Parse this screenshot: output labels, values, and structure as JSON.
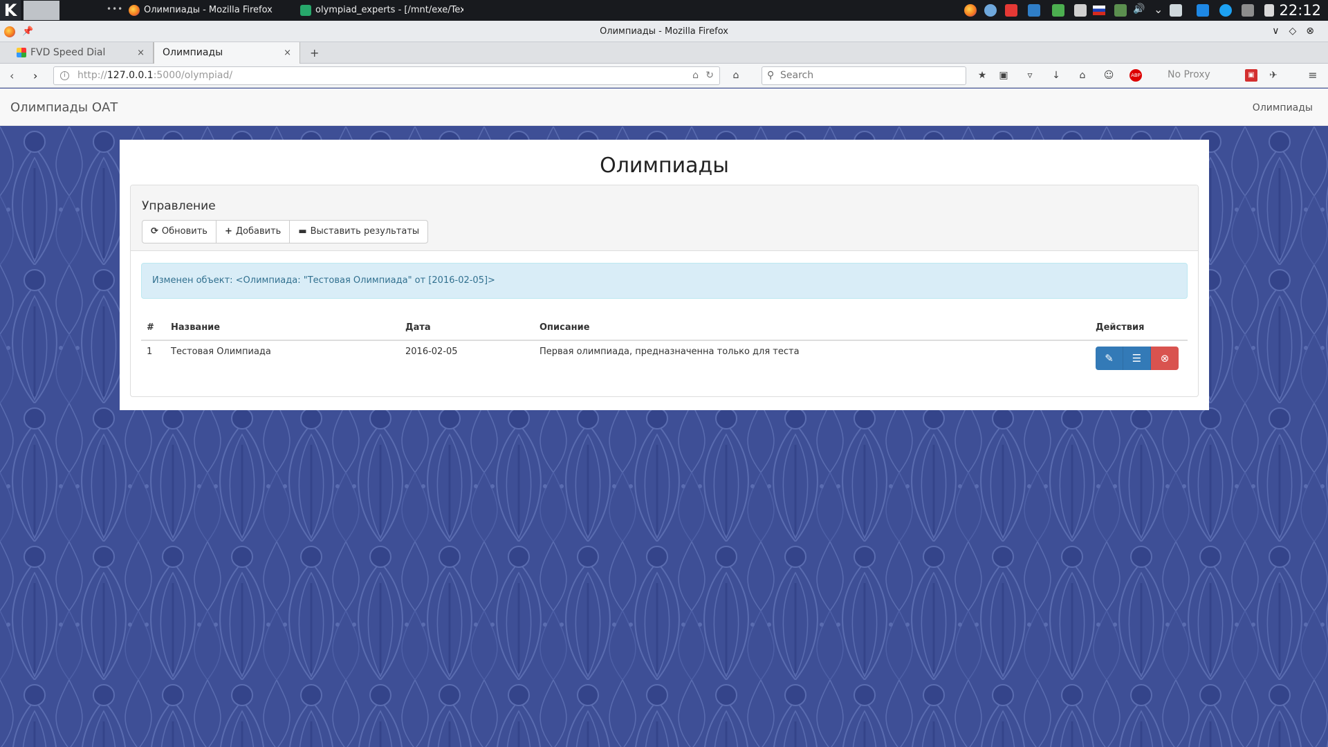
{
  "taskbar": {
    "k_label": "K",
    "dots": "•••",
    "task1": "Олимпиады - Mozilla Firefox",
    "task2": "olympiad_experts - [/mnt/exe/Text/",
    "clock": "22:12"
  },
  "window": {
    "title": "Олимпиады - Mozilla Firefox",
    "controls": "∨◇⊗"
  },
  "tabs": [
    {
      "label": "FVD Speed Dial",
      "close": "×"
    },
    {
      "label": "Олимпиады",
      "close": "×"
    }
  ],
  "newtab": "+",
  "nav": {
    "url_prefix": "http://",
    "url_host": "127.0.0.1",
    "url_rest": ":5000/olympiad/",
    "search_placeholder": "Search",
    "no_proxy": "No Proxy"
  },
  "site": {
    "brand": "Олимпиады ОАТ",
    "nav_link": "Олимпиады"
  },
  "page": {
    "title": "Олимпиады",
    "panel_title": "Управление",
    "buttons": {
      "refresh": "Обновить",
      "add": "Добавить",
      "results": "Выставить результаты"
    },
    "alert": "Изменен объект: <Олимпиада: \"Тестовая Олимпиада\" от [2016-02-05]>"
  },
  "table": {
    "headers": [
      "#",
      "Название",
      "Дата",
      "Описание",
      "Действия"
    ],
    "rows": [
      {
        "num": "1",
        "name": "Тестовая Олимпиада",
        "date": "2016-02-05",
        "description": "Первая олимпиада, предназначенна только для теста"
      }
    ]
  },
  "colors": {
    "background_pattern": "#3e4f96",
    "primary": "#337ab7",
    "danger": "#d9534f",
    "alert_bg": "#d9edf7"
  }
}
